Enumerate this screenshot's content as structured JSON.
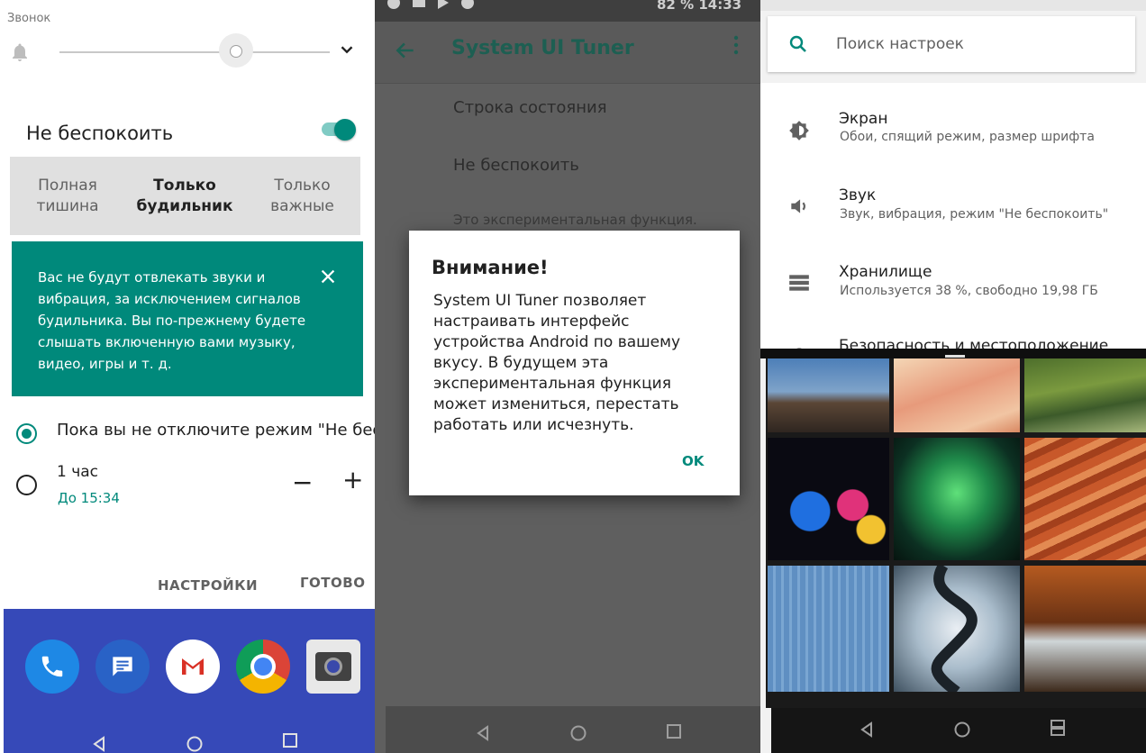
{
  "panel_volume": {
    "ring_label": "Звонок",
    "dnd_title": "Не беспокоить",
    "dnd_enabled": true,
    "modes": [
      {
        "label": "Полная тишина",
        "selected": false
      },
      {
        "label": "Только будильник",
        "selected": true
      },
      {
        "label": "Только важные",
        "selected": false
      }
    ],
    "info_text": "Вас не будут отвлекать звуки и вибрация, за исключением сигналов будильника. Вы по-прежнему будете слышать включенную вами музыку, видео, игры и т. д.",
    "option_until": "Пока вы не отключите режим \"Не бес...",
    "option_hour": "1 час",
    "option_hour_sub": "До 15:34",
    "minus": "−",
    "plus": "+",
    "settings_button": "НАСТРОЙКИ",
    "done_button": "ГОТОВО",
    "dock_apps": [
      "phone-icon",
      "messages-icon",
      "gmail-icon",
      "chrome-icon",
      "camera-icon"
    ],
    "accent_color": "#00897b",
    "dock_color": "#3649b8"
  },
  "panel_tuner": {
    "status_right": "82 %  14:33",
    "title": "System UI Tuner",
    "items": [
      "Строка состояния",
      "Не беспокоить"
    ],
    "experimental_note": "Это экспериментальная функция.",
    "dialog": {
      "title": "Внимание!",
      "body": "System UI Tuner позволяет настраивать интерфейс устройства Android по вашему вкусу. В будущем эта экспериментальная функция может измениться, перестать работать или исчезнуть.",
      "ok": "OK"
    }
  },
  "panel_settings": {
    "search_placeholder": "Поиск настроек",
    "items": [
      {
        "title": "Экран",
        "subtitle": "Обои, спящий режим, размер шрифта",
        "icon": "brightness-icon"
      },
      {
        "title": "Звук",
        "subtitle": "Звук, вибрация, режим \"Не беспокоить\"",
        "icon": "volume-icon"
      },
      {
        "title": "Хранилище",
        "subtitle": "Используется 38 %, свободно 19,98 ГБ",
        "icon": "storage-icon"
      },
      {
        "title": "Безопасность и местоположение",
        "subtitle": "",
        "icon": "location-icon"
      }
    ],
    "wallpapers": [
      "lighthouse",
      "pastel-sand",
      "river-valley",
      "paint-splash",
      "aurora",
      "sandstone-waves",
      "blue-wall",
      "winding-road",
      "autumn-waterfall"
    ]
  }
}
